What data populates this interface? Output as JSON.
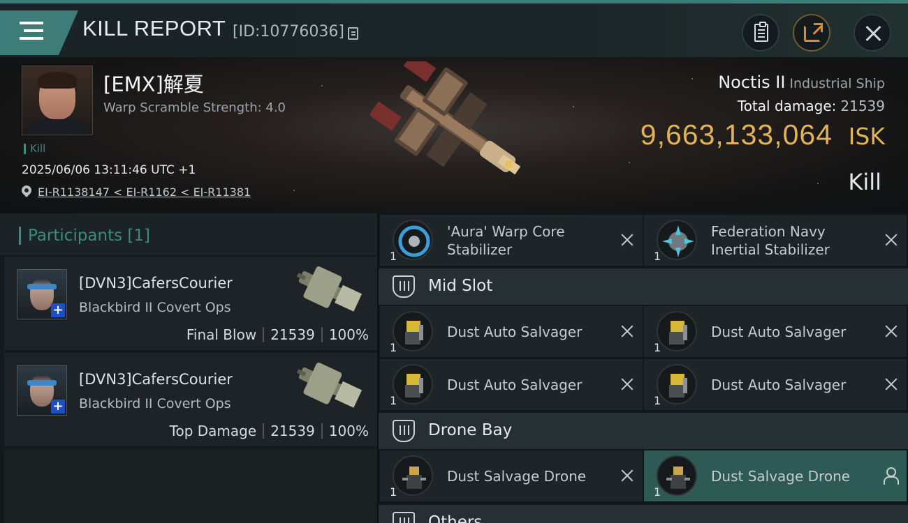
{
  "header": {
    "title": "KILL REPORT",
    "report_id": "[ID:10776036]",
    "icons": {
      "menu": "menu-icon",
      "copy_id": "copy-icon",
      "clipboard": "clipboard-icon",
      "share": "share-icon",
      "close": "close-icon"
    },
    "accent_color": "#3d7c78"
  },
  "victim": {
    "pilot": "[EMX]解夏",
    "warp_scramble": "Warp Scramble Strength: 4.0",
    "kill_tag": "Kill",
    "datetime": "2025/06/06 13:11:46 UTC +1",
    "location": "EI-R1138147 < EI-R1162 < EI-R11381",
    "ship_name": "Noctis II",
    "ship_class": "Industrial Ship",
    "total_damage_label": "Total damage:",
    "total_damage": "21539",
    "isk_value": "9,663,133,064",
    "isk_unit": "ISK",
    "result": "Kill",
    "isk_color": "#e2b256"
  },
  "participants": {
    "title": "Participants [1]",
    "rows": [
      {
        "name": "[DVN3]CafersCourier",
        "ship": "Blackbird II Covert Ops",
        "role": "Final Blow",
        "damage": "21539",
        "percent": "100%"
      },
      {
        "name": "[DVN3]CafersCourier",
        "ship": "Blackbird II Covert Ops",
        "role": "Top Damage",
        "damage": "21539",
        "percent": "100%"
      }
    ]
  },
  "modules": {
    "low_slot": [
      {
        "qty": "1",
        "name": "'Aura' Warp Core Stabilizer",
        "icon": "warp-core-stabilizer-icon"
      },
      {
        "qty": "1",
        "name": "Federation Navy Inertial Stabilizer",
        "icon": "inertial-stabilizer-icon"
      }
    ],
    "mid_slot_label": "Mid Slot",
    "mid_slot": [
      {
        "qty": "1",
        "name": "Dust Auto Salvager",
        "icon": "salvager-icon"
      },
      {
        "qty": "1",
        "name": "Dust Auto Salvager",
        "icon": "salvager-icon"
      },
      {
        "qty": "1",
        "name": "Dust Auto Salvager",
        "icon": "salvager-icon"
      },
      {
        "qty": "1",
        "name": "Dust Auto Salvager",
        "icon": "salvager-icon"
      }
    ],
    "drone_bay_label": "Drone Bay",
    "drone_bay": [
      {
        "qty": "1",
        "name": "Dust Salvage Drone",
        "icon": "drone-icon"
      },
      {
        "qty": "1",
        "name": "Dust Salvage Drone",
        "icon": "drone-icon"
      }
    ],
    "others_label": "Others"
  }
}
